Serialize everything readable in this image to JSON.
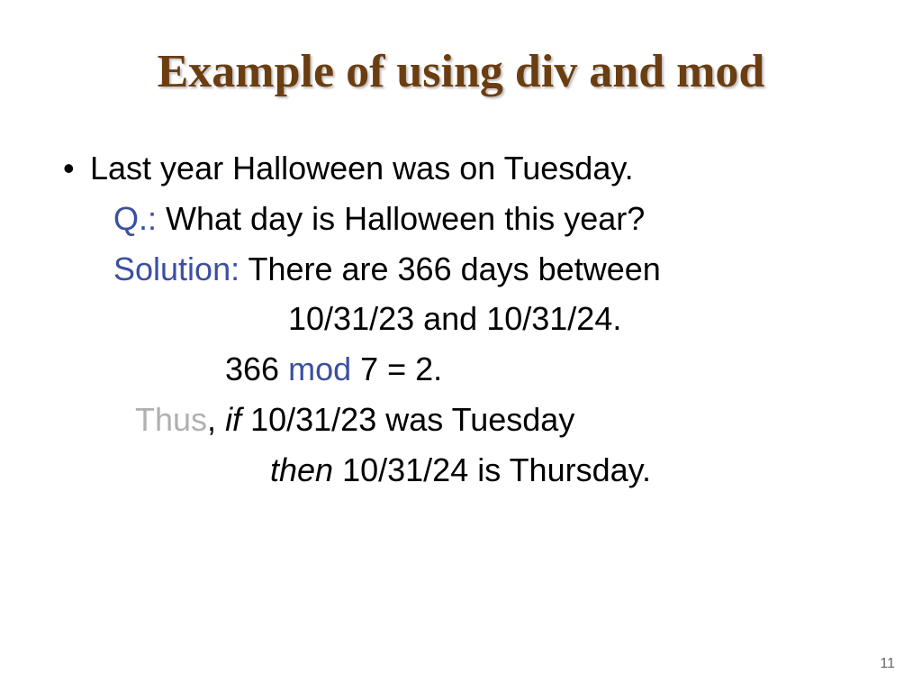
{
  "title": "Example of using div and mod",
  "bullet": "Last year Halloween was on Tuesday.",
  "q_label": "Q.:",
  "q_text": " What day is Halloween this year?",
  "sol_label": "Solution:",
  "sol_text": " There are 366 days between",
  "dates_line": "10/31/23 and 10/31/24.",
  "mod_left": "366 ",
  "mod_word": "mod",
  "mod_right": " 7 = 2.",
  "thus_word": "Thus",
  "thus_comma": ", ",
  "if_word": "if ",
  "thus_text": "10/31/23 was Tuesday",
  "then_word": "then",
  "then_text": " 10/31/24 is Thursday.",
  "page_number": "11"
}
